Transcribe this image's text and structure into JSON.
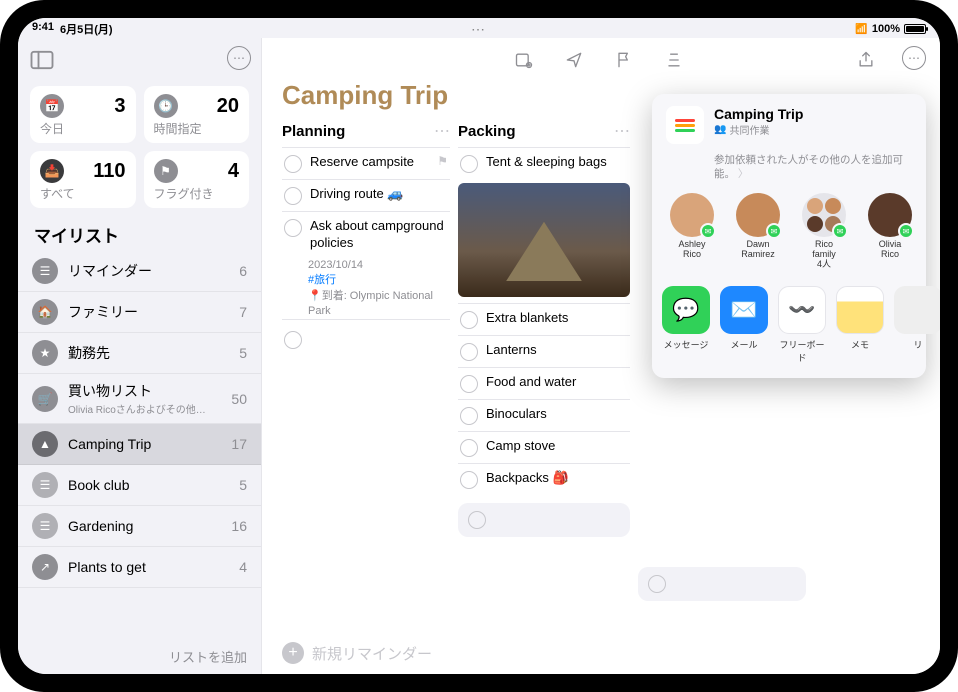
{
  "status": {
    "time": "9:41",
    "date": "6月5日(月)",
    "battery": "100%"
  },
  "sidebar": {
    "smart": [
      {
        "label": "今日",
        "count": 3
      },
      {
        "label": "時間指定",
        "count": 20
      },
      {
        "label": "すべて",
        "count": 110
      },
      {
        "label": "フラグ付き",
        "count": 4
      }
    ],
    "my_lists_label": "マイリスト",
    "lists": [
      {
        "name": "リマインダー",
        "count": 6,
        "color": "#8e8e93"
      },
      {
        "name": "ファミリー",
        "count": 7,
        "color": "#8e8e93"
      },
      {
        "name": "勤務先",
        "count": 5,
        "color": "#8e8e93"
      },
      {
        "name": "買い物リスト",
        "sub": "Olivia Ricoさんおよびその他…",
        "count": 50,
        "color": "#8e8e93"
      },
      {
        "name": "Camping Trip",
        "count": 17,
        "color": "#6b6b70",
        "selected": true
      },
      {
        "name": "Book club",
        "count": 5,
        "color": "#b0b0b5"
      },
      {
        "name": "Gardening",
        "count": 16,
        "color": "#b0b0b5"
      },
      {
        "name": "Plants to get",
        "count": 4,
        "color": "#8e8e93"
      }
    ],
    "add_list": "リストを追加"
  },
  "main": {
    "title": "Camping Trip",
    "new_reminder": "新規リマインダー",
    "columns": [
      {
        "title": "Planning",
        "items": [
          {
            "text": "Reserve campsite",
            "flagged": true
          },
          {
            "text": "Driving route 🚙"
          },
          {
            "text": "Ask about campground policies",
            "meta": {
              "date": "2023/10/14",
              "tag": "#旅行",
              "loc_prefix": "到着:",
              "loc": "Olympic National Park"
            }
          }
        ]
      },
      {
        "title": "Packing",
        "items": [
          {
            "text": "Tent & sleeping bags",
            "image": true
          },
          {
            "text": "Extra blankets"
          },
          {
            "text": "Lanterns"
          },
          {
            "text": "Food and water"
          },
          {
            "text": "Binoculars"
          },
          {
            "text": "Camp stove"
          },
          {
            "text": "Backpacks 🎒"
          }
        ]
      }
    ]
  },
  "share": {
    "title": "Camping Trip",
    "subtitle": "共同作業",
    "note": "参加依頼された人がその他の人を追加可能。",
    "people": [
      {
        "name": "Ashley Rico",
        "color": "#d9a47a"
      },
      {
        "name": "Dawn Ramirez",
        "color": "#c78a5a"
      },
      {
        "name": "Rico family",
        "sub": "4人",
        "group": true
      },
      {
        "name": "Olivia Rico",
        "color": "#5a3a2a"
      }
    ],
    "apps": [
      {
        "label": "メッセージ",
        "kind": "msg"
      },
      {
        "label": "メール",
        "kind": "mail"
      },
      {
        "label": "フリーボード",
        "kind": "free"
      },
      {
        "label": "メモ",
        "kind": "memo"
      }
    ]
  }
}
